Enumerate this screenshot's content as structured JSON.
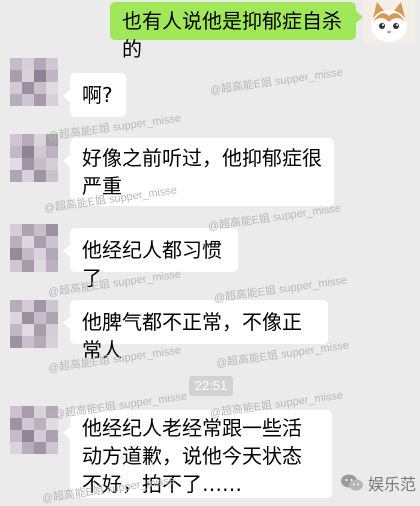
{
  "messages": [
    {
      "side": "right",
      "text": "也有人说他是抑郁症自杀的"
    },
    {
      "side": "left",
      "text": "啊?"
    },
    {
      "side": "left",
      "text": "好像之前听过，他抑郁症很严重"
    },
    {
      "side": "left",
      "text": "他经纪人都习惯了"
    },
    {
      "side": "left",
      "text": "他脾气都不正常，不像正常人"
    },
    {
      "side": "left",
      "text": "他经纪人老经常跟一些活动方道歉，说他今天状态不好，拍不了……"
    }
  ],
  "timestamp": "22:51",
  "watermark": {
    "text1": "@超高能E姐 supper_misse",
    "text2": "@超高能E姐 supper_misse"
  },
  "brand": {
    "name": "娱乐范",
    "icon": "wechat-icon"
  },
  "colors": {
    "background": "#ebebeb",
    "self_bubble": "#a0e75a",
    "other_bubble": "#ffffff"
  }
}
